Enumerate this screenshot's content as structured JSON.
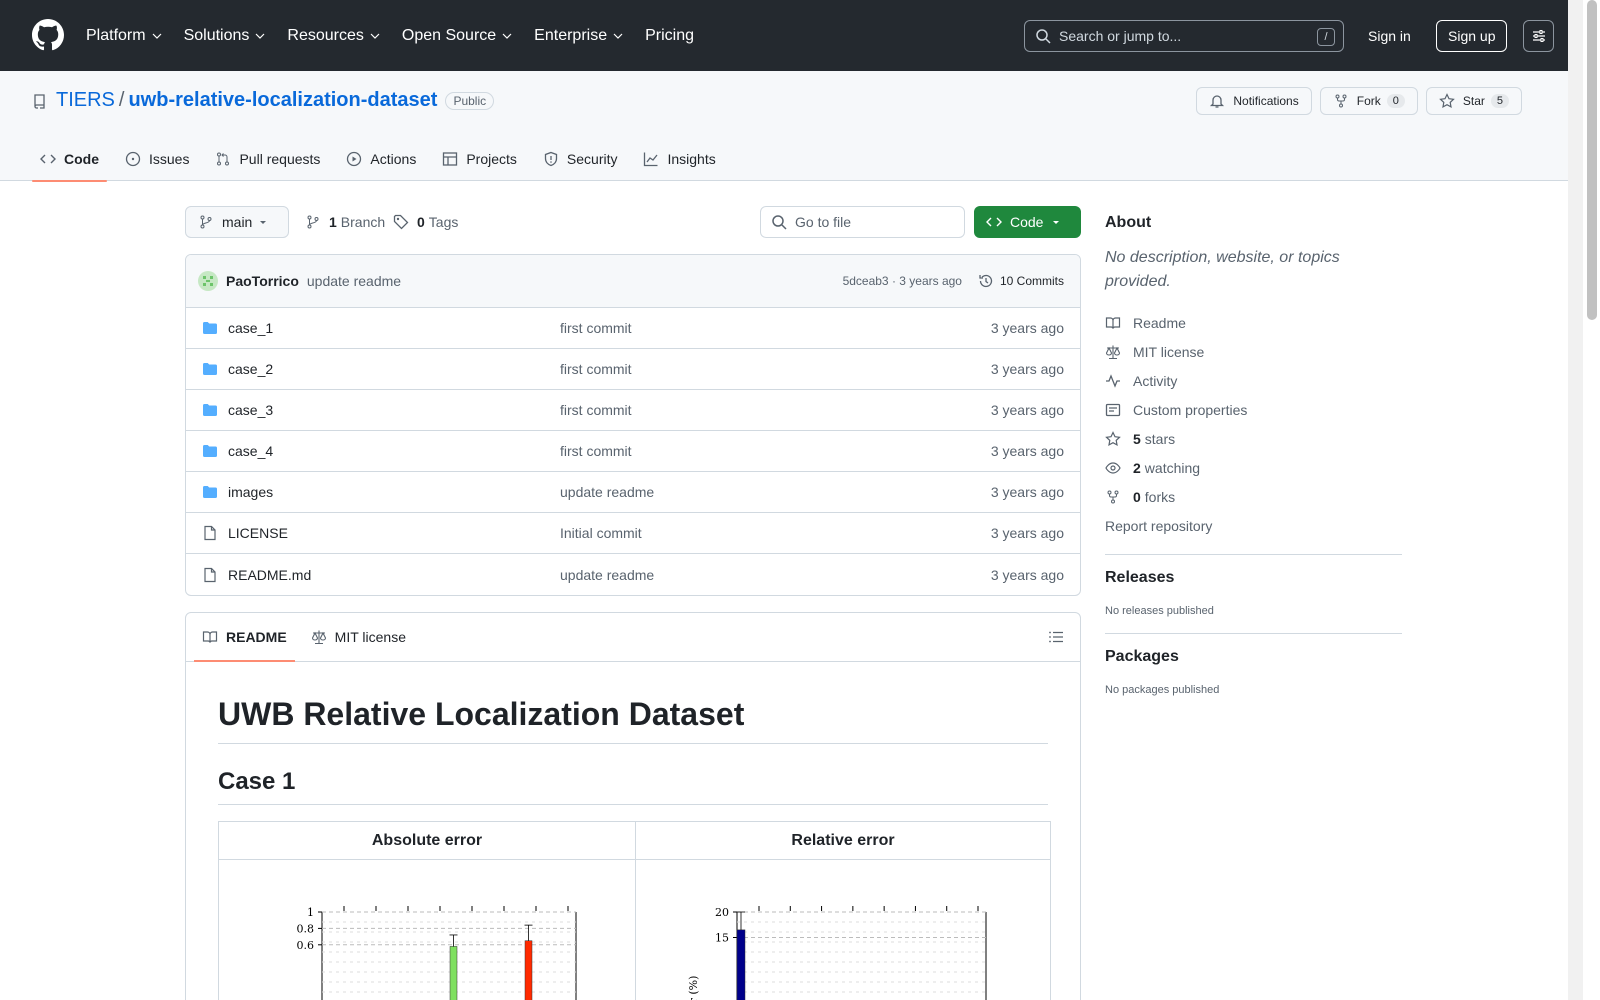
{
  "header": {
    "nav": [
      "Platform",
      "Solutions",
      "Resources",
      "Open Source",
      "Enterprise",
      "Pricing"
    ],
    "search_placeholder": "Search or jump to...",
    "search_shortcut": "/",
    "signin": "Sign in",
    "signup": "Sign up"
  },
  "repo": {
    "owner": "TIERS",
    "separator": "/",
    "name": "uwb-relative-localization-dataset",
    "visibility": "Public",
    "actions": {
      "notifications": "Notifications",
      "fork": "Fork",
      "fork_count": "0",
      "star": "Star",
      "star_count": "5"
    },
    "tabs": [
      "Code",
      "Issues",
      "Pull requests",
      "Actions",
      "Projects",
      "Security",
      "Insights"
    ]
  },
  "files": {
    "branch": "main",
    "branch_count": "1",
    "branch_label": "Branch",
    "tag_count": "0",
    "tag_label": "Tags",
    "goto_placeholder": "Go to file",
    "code_button": "Code",
    "last_commit": {
      "author": "PaoTorrico",
      "message": "update readme",
      "hash_time": "5dceab3 · 3 years ago",
      "commits": "10 Commits"
    },
    "rows": [
      {
        "name": "case_1",
        "type": "folder",
        "message": "first commit",
        "date": "3 years ago"
      },
      {
        "name": "case_2",
        "type": "folder",
        "message": "first commit",
        "date": "3 years ago"
      },
      {
        "name": "case_3",
        "type": "folder",
        "message": "first commit",
        "date": "3 years ago"
      },
      {
        "name": "case_4",
        "type": "folder",
        "message": "first commit",
        "date": "3 years ago"
      },
      {
        "name": "images",
        "type": "folder",
        "message": "update readme",
        "date": "3 years ago"
      },
      {
        "name": "LICENSE",
        "type": "file",
        "message": "Initial commit",
        "date": "3 years ago"
      },
      {
        "name": "README.md",
        "type": "file",
        "message": "update readme",
        "date": "3 years ago"
      }
    ]
  },
  "readme": {
    "tab_readme": "README",
    "tab_license": "MIT license",
    "title": "UWB Relative Localization Dataset",
    "section": "Case 1",
    "table_headers": [
      "Absolute error",
      "Relative error"
    ]
  },
  "sidebar": {
    "about_title": "About",
    "description": "No description, website, or topics provided.",
    "links": {
      "readme": "Readme",
      "license": "MIT license",
      "activity": "Activity",
      "custom": "Custom properties",
      "stars_count": "5",
      "stars_label": "stars",
      "watching_count": "2",
      "watching_label": "watching",
      "forks_count": "0",
      "forks_label": "forks",
      "report": "Report repository"
    },
    "releases_title": "Releases",
    "releases_text": "No releases published",
    "packages_title": "Packages",
    "packages_text": "No packages published"
  },
  "chart_data": [
    {
      "type": "bar",
      "ylim": [
        0,
        1
      ],
      "yticks": [
        "0.6",
        "0.8",
        "1"
      ],
      "ylabel_fragment": ")",
      "bars": [
        {
          "color": "#7fe060",
          "value": 0.58,
          "error_top": 0.72
        },
        {
          "color": "#ff2a00",
          "value": 0.65,
          "error_top": 0.84
        }
      ]
    },
    {
      "type": "bar",
      "ylim": [
        0,
        20
      ],
      "yticks": [
        "15",
        "20"
      ],
      "ylabel_fragment": "or (%)",
      "bars": [
        {
          "color": "#00008b",
          "value": 16.5,
          "error_top": 20
        }
      ]
    }
  ]
}
